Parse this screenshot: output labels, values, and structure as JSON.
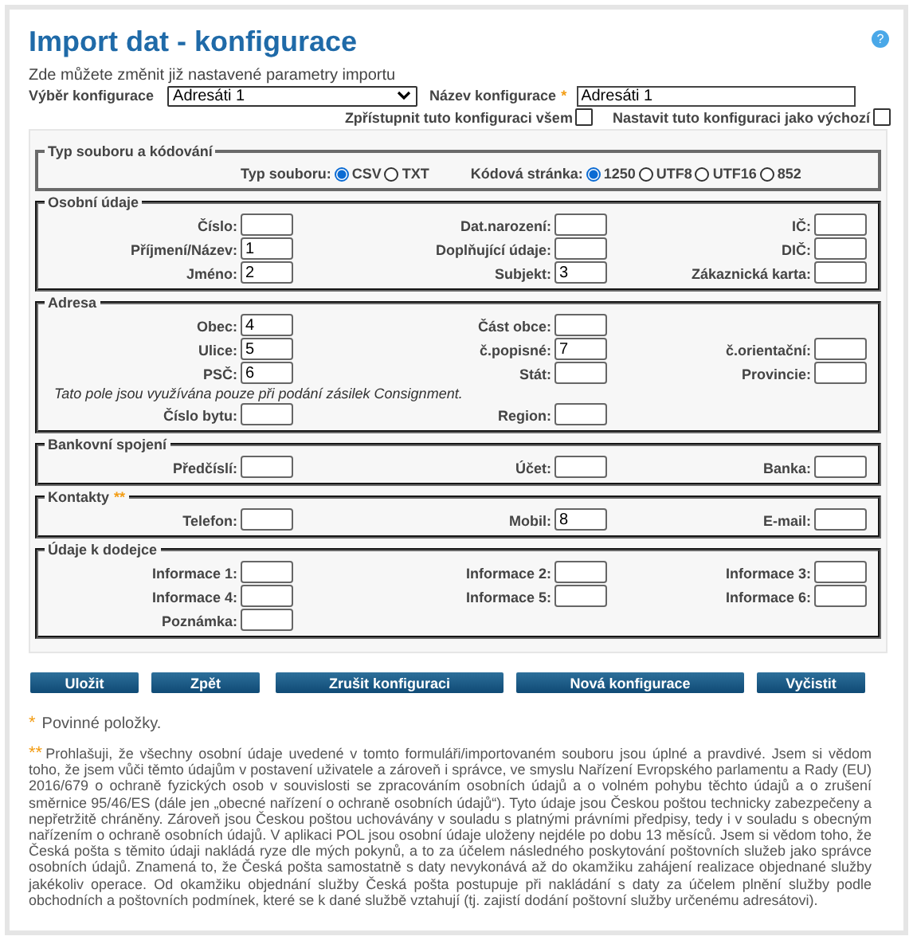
{
  "title": "Import dat - konfigurace",
  "help": "?",
  "subtitle": "Zde můžete změnit již nastavené parametry importu",
  "config_select": {
    "label": "Výběr konfigurace",
    "value": "Adresáti 1"
  },
  "config_name": {
    "label": "Název konfigurace",
    "required_mark": "*",
    "value": "Adresáti 1"
  },
  "checkboxes": [
    {
      "label": "Zpřístupnit tuto konfiguraci všem",
      "checked": false
    },
    {
      "label": "Nastavit tuto konfiguraci jako výchozí",
      "checked": false
    }
  ],
  "file_section": {
    "legend": "Typ souboru a kódování",
    "groups": [
      {
        "label": "Typ souboru:",
        "options": [
          {
            "label": "CSV",
            "selected": true
          },
          {
            "label": "TXT",
            "selected": false
          }
        ]
      },
      {
        "label": "Kódová stránka:",
        "options": [
          {
            "label": "1250",
            "selected": true
          },
          {
            "label": "UTF8",
            "selected": false
          },
          {
            "label": "UTF16",
            "selected": false
          },
          {
            "label": "852",
            "selected": false
          }
        ]
      }
    ]
  },
  "sections": [
    {
      "legend": "Osobní údaje",
      "rows": [
        {
          "kind": "fields",
          "fields": [
            {
              "label": "Číslo:"
            },
            {
              "label": "Dat.narození:"
            },
            {
              "label": "IČ:"
            }
          ]
        },
        {
          "kind": "fields",
          "fields": [
            {
              "label": "Příjmení/Název:",
              "value": "1"
            },
            {
              "label": "Doplňující údaje:"
            },
            {
              "label": "DIČ:"
            }
          ]
        },
        {
          "kind": "fields",
          "fields": [
            {
              "label": "Jméno:",
              "value": "2"
            },
            {
              "label": "Subjekt:",
              "value": "3"
            },
            {
              "label": "Zákaznická karta:"
            }
          ]
        }
      ]
    },
    {
      "legend": "Adresa",
      "rows": [
        {
          "kind": "fields",
          "fields": [
            {
              "label": "Obec:",
              "value": "4"
            },
            {
              "label": "Část obce:"
            }
          ]
        },
        {
          "kind": "fields",
          "fields": [
            {
              "label": "Ulice:",
              "value": "5"
            },
            {
              "label": "č.popisné:",
              "value": "7"
            },
            {
              "label": "č.orientační:"
            }
          ]
        },
        {
          "kind": "fields",
          "fields": [
            {
              "label": "PSČ:",
              "value": "6"
            },
            {
              "label": "Stát:"
            },
            {
              "label": "Provincie:"
            }
          ]
        },
        {
          "kind": "note",
          "text": "Tato pole jsou využívána pouze při podání zásilek Consignment."
        },
        {
          "kind": "fields",
          "fields": [
            {
              "label": "Číslo bytu:"
            },
            {
              "label": "Region:"
            }
          ]
        }
      ]
    },
    {
      "legend": "Bankovní spojení",
      "rows": [
        {
          "kind": "fields",
          "fields": [
            {
              "label": "Předčíslí:"
            },
            {
              "label": "Účet:"
            },
            {
              "label": "Banka:"
            }
          ]
        }
      ]
    },
    {
      "legend": "Kontakty",
      "legend_mark": "**",
      "rows": [
        {
          "kind": "fields",
          "fields": [
            {
              "label": "Telefon:"
            },
            {
              "label": "Mobil:",
              "value": "8"
            },
            {
              "label": "E-mail:"
            }
          ]
        }
      ]
    },
    {
      "legend": "Údaje k dodejce",
      "rows": [
        {
          "kind": "fields",
          "fields": [
            {
              "label": "Informace 1:"
            },
            {
              "label": "Informace 2:"
            },
            {
              "label": "Informace 3:"
            }
          ]
        },
        {
          "kind": "fields",
          "fields": [
            {
              "label": "Informace 4:"
            },
            {
              "label": "Informace 5:"
            },
            {
              "label": "Informace 6:"
            }
          ]
        },
        {
          "kind": "fields",
          "fields": [
            {
              "label": "Poznámka:"
            }
          ]
        }
      ]
    }
  ],
  "buttons": [
    "Uložit",
    "Zpět",
    "Zrušit konfiguraci",
    "Nová konfigurace",
    "Vyčistit"
  ],
  "required_note": {
    "mark": "*",
    "text": "Povinné položky."
  },
  "consent_note": {
    "mark": "**",
    "text": "Prohlašuji, že všechny osobní údaje uvedené v tomto formuláři/importovaném souboru jsou úplné a pravdivé. Jsem si vědom toho, že jsem vůči těmto údajům v postavení uživatele a zároveň i správce, ve smyslu Nařízení Evropského parlamentu a Rady (EU) 2016/679 o ochraně fyzických osob v souvislosti se zpracováním osobních údajů a o volném pohybu těchto údajů a o zrušení směrnice 95/46/ES (dále jen „obecné nařízení o ochraně osobních údajů“). Tyto údaje jsou Českou poštou technicky zabezpečeny a nepřetržitě chráněny. Zároveň jsou Českou poštou uchovávány v souladu s platnými právními předpisy, tedy i v souladu s obecným nařízením o ochraně osobních údajů. V aplikaci POL jsou osobní údaje uloženy nejdéle po dobu 13 měsíců. Jsem si vědom toho, že Česká pošta s těmito údaji nakládá ryze dle mých pokynů, a to za účelem následného poskytování poštovních služeb jako správce osobních údajů. Znamená to, že Česká pošta samostatně s daty nevykonává až do okamžiku zahájení realizace objednané služby jakékoliv operace. Od okamžiku objednání služby Česká pošta postupuje při nakládání s daty za účelem plnění služby podle obchodních a poštovních podmínek, které se k dané službě vztahují (tj. zajistí dodání poštovní služby určenému adresátovi)."
  }
}
